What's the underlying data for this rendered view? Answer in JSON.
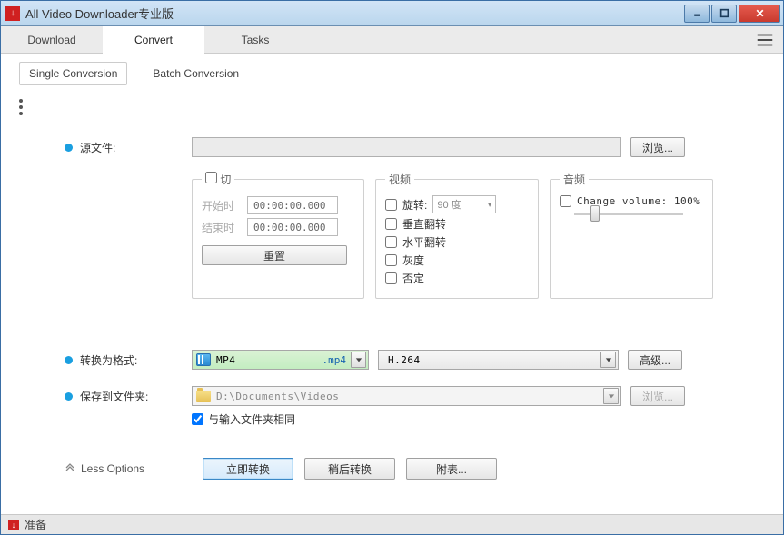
{
  "title": "All Video Downloader专业版",
  "tabs": {
    "download": "Download",
    "convert": "Convert",
    "tasks": "Tasks"
  },
  "subtabs": {
    "single": "Single Conversion",
    "batch": "Batch Conversion"
  },
  "labels": {
    "source": "源文件:",
    "convert_to": "转换为格式:",
    "save_to": "保存到文件夹:",
    "less_options": "Less Options"
  },
  "source": {
    "value": "",
    "browse": "浏览..."
  },
  "cut": {
    "legend": "切",
    "start_label": "开始时",
    "end_label": "结束时",
    "start_value": "00:00:00.000",
    "end_value": "00:00:00.000",
    "reset": "重置"
  },
  "video": {
    "legend": "视频",
    "rotate_label": "旋转:",
    "rotate_value": "90 度",
    "flip_v": "垂直翻转",
    "flip_h": "水平翻转",
    "gray": "灰度",
    "negate": "否定"
  },
  "audio": {
    "legend": "音频",
    "change_vol": "Change volume: 100%"
  },
  "format": {
    "name": "MP4",
    "ext": ".mp4",
    "codec": "H.264",
    "advanced": "高级..."
  },
  "save": {
    "path": "D:\\Documents\\Videos",
    "same_as_input": "与输入文件夹相同",
    "browse": "浏览..."
  },
  "actions": {
    "convert_now": "立即转换",
    "convert_later": "稍后转换",
    "append": "附表..."
  },
  "status": "准备"
}
